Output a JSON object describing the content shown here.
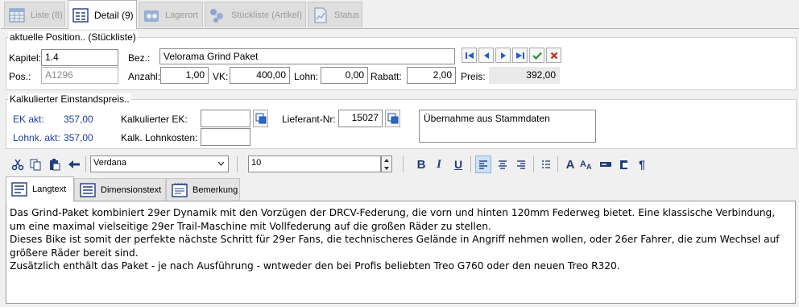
{
  "top_tabs": [
    {
      "label": "Liste (8)",
      "icon": "table-grid-icon"
    },
    {
      "label": "Detail (9)",
      "icon": "form-detail-icon"
    },
    {
      "label": "Lagerort",
      "icon": "warehouse-box-icon"
    },
    {
      "label": "Stückliste (Artikel)",
      "icon": "parts-list-icon"
    },
    {
      "label": "Status",
      "icon": "status-chart-icon"
    }
  ],
  "position": {
    "title": "aktuelle Position.. (Stückliste)",
    "kapitel_label": "Kapitel:",
    "kapitel_value": "1.4",
    "bez_label": "Bez.:",
    "bez_value": "Velorama Grind Paket",
    "pos_label": "Pos.:",
    "pos_value": "A1296",
    "anzahl_label": "Anzahl:",
    "anzahl_value": "1,00",
    "vk_label": "VK:",
    "vk_value": "400,00",
    "lohn_label": "Lohn:",
    "lohn_value": "0,00",
    "rabatt_label": "Rabatt:",
    "rabatt_value": "2,00",
    "preis_label": "Preis:",
    "preis_value": "392,00"
  },
  "kalk": {
    "title": "Kalkulierter Einstandspreis..",
    "ek_akt_label": "EK akt:",
    "ek_akt_value": "357,00",
    "lohnk_akt_label": "Lohnk. akt:",
    "lohnk_akt_value": "357,00",
    "kalk_ek_label": "Kalkulierter EK:",
    "kalk_ek_value": "",
    "kalk_lohn_label": "Kalk. Lohnkosten:",
    "kalk_lohn_value": "",
    "lieferant_label": "Lieferant-Nr:",
    "lieferant_value": "15027",
    "stammdaten_text": "Übernahme aus Stammdaten"
  },
  "toolbar": {
    "font_name": "Verdana",
    "font_size": "10"
  },
  "lower_tabs": [
    {
      "label": "Langtext",
      "icon": "text-lines-icon"
    },
    {
      "label": "Dimensionstext",
      "icon": "dimension-text-icon"
    },
    {
      "label": "Bemerkung",
      "icon": "note-icon"
    }
  ],
  "langtext": [
    "Das Grind-Paket kombiniert 29er Dynamik mit den Vorzügen der DRCV-Federung, die vorn und hinten 120mm Federweg bietet. Eine klassische Verbindung, um eine maximal vielseitige 29er Trail-Maschine mit Vollfederung auf die großen Räder zu stellen.",
    "Dieses Bike ist somit der perfekte nächste Schritt für 29er Fans, die technischeres Gelände in Angriff nehmen wollen, oder 26er Fahrer, die zum Wechsel auf größere Räder bereit sind.",
    "Zusätzlich enthält das Paket - je nach Ausführung - wntweder den bei Profis beliebten Treo G760 oder den neuen Treo R320."
  ],
  "colors": {
    "accent_blue": "#1c3f9c",
    "confirm_green": "#2e8b2e",
    "cancel_red": "#d32020",
    "nav_blue": "#1e5bd6"
  }
}
